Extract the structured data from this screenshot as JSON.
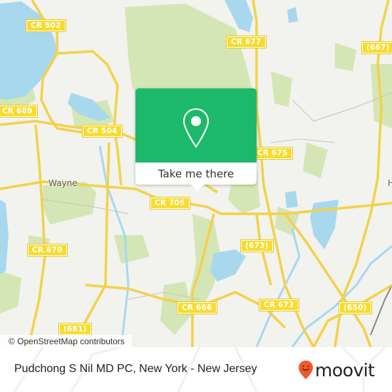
{
  "map": {
    "colors": {
      "land": "#f2f2ee",
      "park": "#d4e6b5",
      "water": "#a8d8ee",
      "road": "#f7dc5a",
      "road_label_bg": "#f7dc2d"
    },
    "road_labels": [
      {
        "id": "cr502",
        "text": "CR 502"
      },
      {
        "id": "cr677",
        "text": "CR 677"
      },
      {
        "id": "667",
        "text": "(667)"
      },
      {
        "id": "cr689",
        "text": "CR 689"
      },
      {
        "id": "cr504",
        "text": "CR 504"
      },
      {
        "id": "cr675",
        "text": "CR 675"
      },
      {
        "id": "cr705",
        "text": "CR 705"
      },
      {
        "id": "673",
        "text": "(673)"
      },
      {
        "id": "cr670",
        "text": "CR 670"
      },
      {
        "id": "cr666",
        "text": "CR 666"
      },
      {
        "id": "cr673",
        "text": "CR 673"
      },
      {
        "id": "650",
        "text": "(650)"
      },
      {
        "id": "681",
        "text": "(681)"
      }
    ],
    "place_labels": [
      {
        "id": "wayne",
        "text": "Wayne"
      },
      {
        "id": "edge-h",
        "text": "H"
      }
    ],
    "attribution": "© OpenStreetMap contributors"
  },
  "popup": {
    "icon": "map-pin-icon",
    "button_label": "Take me there",
    "accent": "#1db96b"
  },
  "footer": {
    "title": "Pudchong S Nil MD PC, New York - New Jersey",
    "logo_text": "moovit",
    "logo_icon": "moovit-pin-icon",
    "logo_color": "#f05a28"
  }
}
